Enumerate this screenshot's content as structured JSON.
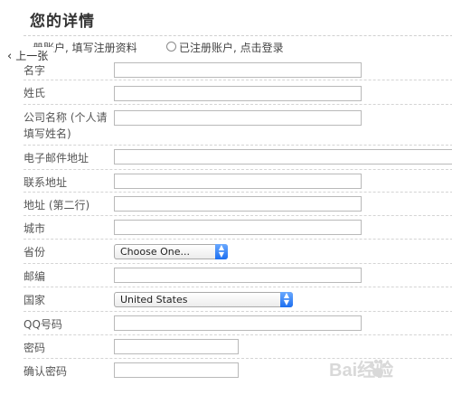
{
  "section": {
    "title": "您的详情"
  },
  "account_choice": {
    "option_new": "册账户, 填写注册资料",
    "option_existing": "已注册账户, 点击登录"
  },
  "nav": {
    "prev_label": "上一张"
  },
  "form": {
    "first_name": {
      "label": "名字",
      "value": ""
    },
    "last_name": {
      "label": "姓氏",
      "value": ""
    },
    "company": {
      "label": "公司名称 (个人请填写姓名)",
      "value": ""
    },
    "email": {
      "label": "电子邮件地址",
      "value": ""
    },
    "address1": {
      "label": "联系地址",
      "value": ""
    },
    "address2": {
      "label": "地址 (第二行)",
      "value": ""
    },
    "city": {
      "label": "城市",
      "value": ""
    },
    "province": {
      "label": "省份",
      "selected": "Choose One..."
    },
    "postcode": {
      "label": "邮编",
      "value": ""
    },
    "country": {
      "label": "国家",
      "selected": "United States"
    },
    "qq": {
      "label": "QQ号码",
      "value": ""
    },
    "password": {
      "label": "密码",
      "value": ""
    },
    "confirm_password": {
      "label": "确认密码",
      "value": ""
    }
  },
  "watermark": {
    "text": "Bai经验"
  },
  "colors": {
    "select_arrow": "#1d6ff0",
    "border": "#b9b9b9",
    "watermark": "#d9d9d9"
  }
}
